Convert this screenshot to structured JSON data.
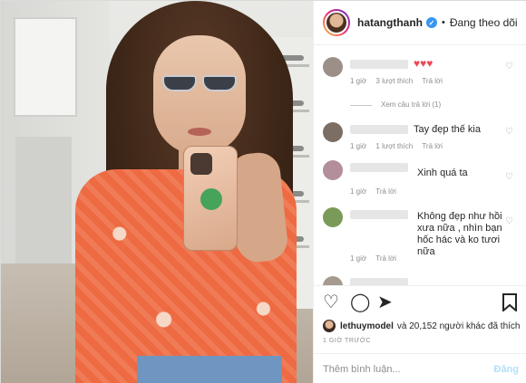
{
  "post": {
    "username": "hatangthanh",
    "verified": true,
    "follow_label": "Đang theo dõi"
  },
  "comments": [
    {
      "text_suffix": "♥♥♥",
      "time": "1 giờ",
      "likes": "3 lượt thích",
      "reply": "Trả lời",
      "replies_label": "Xem câu trả lời (1)"
    },
    {
      "text": "Tay đẹp thế kia",
      "time": "1 giờ",
      "likes": "1 lượt thích",
      "reply": "Trả lời"
    },
    {
      "text": "Xinh quá ta",
      "time": "1 giờ",
      "reply": "Trả lời"
    },
    {
      "text": "Không đẹp như hồi xưa nữa , nhìn bạn hốc hác và ko tươi nữa",
      "time": "1 giờ",
      "reply": "Trả lời"
    }
  ],
  "likes_summary": {
    "user": "lethuymodel",
    "rest": "và 20,152 người khác đã thích"
  },
  "time_ago": "1 GIỜ TRƯỚC",
  "add_comment": {
    "placeholder": "Thêm bình luận...",
    "post_label": "Đăng"
  },
  "icons": {
    "heart": "heart-icon",
    "comment": "comment-icon",
    "share": "share-icon",
    "bookmark": "bookmark-icon"
  },
  "colors": {
    "verified": "#3897f0",
    "heart_red": "#ed4956",
    "post_disabled": "#b2dffc"
  }
}
